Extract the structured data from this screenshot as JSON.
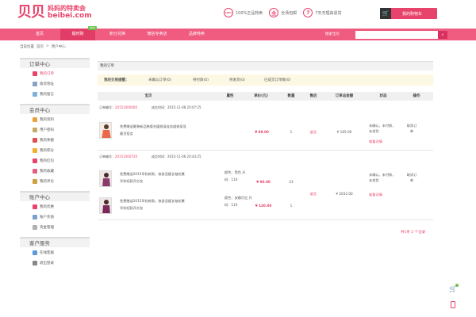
{
  "header": {
    "logo_mark": "贝贝",
    "logo_cn": "妈妈的特卖会",
    "logo_en": "beibei.com",
    "promises": [
      {
        "icon": "100%",
        "label": "100%正品特卖"
      },
      {
        "icon": "全",
        "label": "全场包邮"
      },
      {
        "icon": "7",
        "label": "7天无理由退货"
      }
    ],
    "cart_icon": "🛒",
    "cart_label": "我的购物车"
  },
  "nav": {
    "items": [
      "首页",
      "婚时购",
      "积分兑换",
      "微信专卖店",
      "品牌特卖"
    ],
    "badge": "NEW",
    "search_label": "搜索宝贝",
    "search_placeholder": "",
    "search_icon": "search-icon"
  },
  "breadcrumb": [
    "当前位置",
    "首页",
    ">",
    "用户中心"
  ],
  "sidebar": {
    "groups": [
      {
        "title": "订单中心",
        "items": [
          "我的订单",
          "收货地址",
          "我的留言"
        ]
      },
      {
        "title": "会员中心",
        "items": [
          "我的资料",
          "用户密码",
          "我的余额",
          "我的积分",
          "我的红包",
          "我的收藏",
          "我的评论"
        ]
      },
      {
        "title": "账户中心",
        "items": [
          "我的优惠",
          "账户充值",
          "资金管理"
        ]
      },
      {
        "title": "客户服务",
        "items": [
          "在线客服",
          "退出登录"
        ]
      }
    ]
  },
  "main": {
    "title": "我的订单",
    "reminder": {
      "label": "我的交易提醒：",
      "items": [
        "未确认订单(0)",
        "待付款(0)",
        "待发货(0)",
        "已成交订单数(0)"
      ]
    },
    "table_headers": [
      "宝贝",
      "属性",
      "单价(元)",
      "数量",
      "售后",
      "订单总金额",
      "状态",
      "操作"
    ],
    "orders": [
      {
        "order_label": "订单编号：",
        "order_no": "20151000000",
        "time_label": "成交时间：",
        "time": "2015-11-08 20:07:25",
        "products": [
          {
            "title": "免费赠送夏装新品韩版名媛修身连衣裙修身显瘦百搭女",
            "attr": "",
            "price": "¥ 88.00",
            "qty": "1",
            "service": "留言"
          }
        ],
        "total": "¥ 165.00",
        "status": "未确认，未付款，未发货",
        "detail": "查看详情",
        "action": "取消订单"
      },
      {
        "order_label": "订单编号：",
        "order_no": "20151000720",
        "time_label": "成交时间：",
        "time": "2015-11-06 20:43:25",
        "products": [
          {
            "title": "免费赠送2015早秋新款，修身显瘦长袖花裹早秋短款开衫女",
            "attr": "颜色：黑色 尺码：110",
            "price": "¥ 80.00",
            "qty": "23",
            "service": ""
          },
          {
            "title": "免费赠送2015早秋新款，修身显瘦长袖花裹早秋短款开衫女",
            "attr": "颜色：安娜灯红 尺码：110",
            "price": "¥ 120.00",
            "qty": "1",
            "service": "留言"
          }
        ],
        "total": "¥ 2032.00",
        "status": "未确认，未付款，未发货",
        "detail": "查看详情",
        "action": "取消订单"
      }
    ],
    "pager": "共1条  2  个记录"
  },
  "colors": {
    "brand": "#e8436a",
    "nav": "#f05b80",
    "nav_active": "#e23d66"
  }
}
